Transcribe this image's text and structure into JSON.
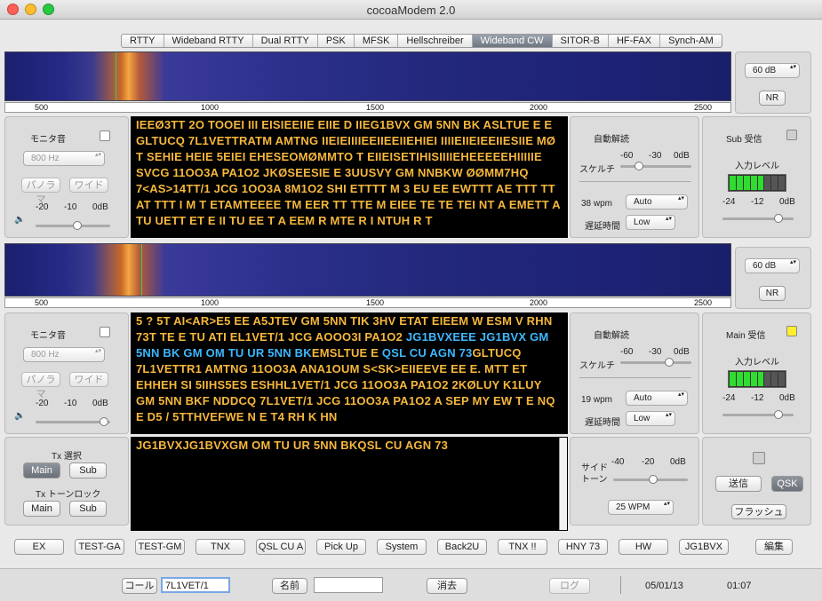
{
  "window": {
    "title": "cocoaModem 2.0"
  },
  "tabs": [
    "RTTY",
    "Wideband RTTY",
    "Dual RTTY",
    "PSK",
    "MFSK",
    "Hellschreiber",
    "Wideband CW",
    "SITOR-B",
    "HF-FAX",
    "Synch-AM"
  ],
  "selected_tab": "Wideband CW",
  "scale_ticks": [
    "500",
    "1000",
    "1500",
    "2000",
    "2500"
  ],
  "receiver1": {
    "db_select": "60 dB",
    "nr": "NR",
    "monitor": "モニタ音",
    "freq": "800 Hz",
    "panorama": "パノラマ",
    "wide": "ワイド",
    "vol_ticks": [
      "-20",
      "-10",
      "0dB"
    ],
    "auto_decode": "自動解読",
    "squelch": "スケルチ",
    "sq_ticks": [
      "-60",
      "-30",
      "0dB"
    ],
    "wpm": "38 wpm",
    "wpm_mode": "Auto",
    "delay_label": "遅延時間",
    "delay": "Low",
    "sub_label": "Sub 受信",
    "input_level": "入力レベル",
    "level_ticks": [
      "-24",
      "-12",
      "0dB"
    ],
    "text": "IEEØ3TT 2O TOOEI III EISIEEIIE EIIE D IIEG1BVX GM 5NN BK ASLTUE E E GLTUCQ 7L1VETTRATM AMTNG IIEIEIIIIEEIIEEIIEHIEI IIIIEIIEIEEIIESIIE MØ T SEHIE HEIE 5EIEI EHESEOMØMMTO T EIIEISETIHISIIIIEHEEEEEHIIIIIE SVCG 11OO3A PA1O2 JKØSEESIE E 3UUSVY GM NNBKW ØØMM7HQ 7<AS>14TT/1 JCG 1OO3A 8M1O2 SHI ETTTT M 3 EU EE EWTTT AE TTT TT AT TTT I M T ETAMTEEEE TM EER TT TTE M EIEE TE TE TEI NT A EMETT A TU UETT ET E II TU EE T A EEM R MTE R I NTUH R T"
  },
  "receiver2": {
    "db_select": "60 dB",
    "nr": "NR",
    "monitor": "モニタ音",
    "freq": "800 Hz",
    "panorama": "パノラマ",
    "wide": "ワイド",
    "vol_ticks": [
      "-20",
      "-10",
      "0dB"
    ],
    "auto_decode": "自動解読",
    "squelch": "スケルチ",
    "sq_ticks": [
      "-60",
      "-30",
      "0dB"
    ],
    "wpm": "19 wpm",
    "wpm_mode": "Auto",
    "delay_label": "遅延時間",
    "delay": "Low",
    "main_label": "Main 受信",
    "input_level": "入力レベル",
    "level_ticks": [
      "-24",
      "-12",
      "0dB"
    ],
    "text_a": "5 ? 5T AI<AR>E5 EE A5JTEV GM 5NN TIK 3HV ETAT EIEEM  W ESM V RHN 73T TE E TU ATI EL1VET/1 JCG AOOO3I PA1O2 ",
    "text_b1": "JG1BVXEEE JG1BVX GM 5NN BK ",
    "text_b2": "GM OM TU UR 5NN BK",
    "text_c": "EMSLTUE E ",
    "text_d": "QSL CU AGN 73",
    "text_e": "GLTUCQ 7L1VETTR1 AMTNG 11OO3A ANA1OUM S<SK>EIIEEVE EE E. MTT ET EHHEH SI 5IIHS5ES ESHHL1VET/1 JCG 11OO3A PA1O2 2KØLUY K1LUY GM 5NN BKF NDDCQ 7L1VET/1 JCG 11OO3A PA1O2 A SEP MY EW T E NQ E D5 / 5TTHVEFWE N E T4 RH K HN"
  },
  "transmit": {
    "tx_select": "Tx 選択",
    "main": "Main",
    "sub": "Sub",
    "tone_lock": "Tx トーンロック",
    "text": "JG1BVXJG1BVXGM OM TU UR 5NN BKQSL CU AGN 73",
    "sidetone": "サイド\nトーン",
    "st_ticks": [
      "-40",
      "-20",
      "0dB"
    ],
    "wpm": "25 WPM",
    "send": "送信",
    "qsk": "QSK",
    "flash": "フラッシュ"
  },
  "macros": [
    "EX",
    "TEST-GA",
    "TEST-GM",
    "TNX",
    "QSL CU A",
    "Pick Up",
    "System",
    "Back2U",
    "TNX !!",
    "HNY 73",
    "HW",
    "JG1BVX"
  ],
  "edit": "編集",
  "bottom": {
    "call_label": "コール",
    "call_value": "7L1VET/1",
    "name_label": "名前",
    "name_value": "",
    "clear": "消去",
    "log": "ログ",
    "date": "05/01/13",
    "time": "01:07"
  },
  "colors": {
    "decoded_text": "#f6b73c",
    "highlight_text": "#3db8ff",
    "selected_tab": "#6d7682"
  }
}
